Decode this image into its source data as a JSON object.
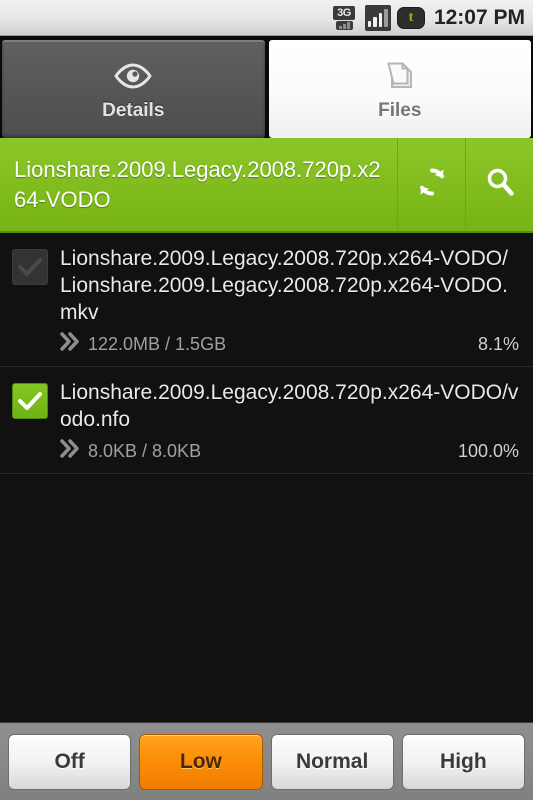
{
  "statusbar": {
    "network_label": "3G",
    "time": "12:07 PM",
    "app_glyph": "t",
    "icons": [
      "3g-network-icon",
      "signal-bars-icon",
      "transmission-app-icon"
    ]
  },
  "tabs": [
    {
      "id": "details",
      "label": "Details",
      "icon": "eye-icon",
      "active": false
    },
    {
      "id": "files",
      "label": "Files",
      "icon": "stacked-pages-icon",
      "active": true
    }
  ],
  "titlebar": {
    "torrent_name": "Lionshare.2009.Legacy.2008.720p.x264-VODO",
    "refresh_icon": "refresh-icon",
    "search_icon": "search-icon",
    "background_color": "#82bd1f"
  },
  "files": [
    {
      "name": "Lionshare.2009.Legacy.2008.720p.x264-VODO/Lionshare.2009.Legacy.2008.720p.x264-VODO.mkv",
      "downloaded": "122.0MB",
      "total": "1.5GB",
      "size_text": "122.0MB / 1.5GB",
      "percent": "8.1%",
      "checked": false,
      "checkbox_state": "unchecked-dim"
    },
    {
      "name": "Lionshare.2009.Legacy.2008.720p.x264-VODO/vodo.nfo",
      "downloaded": "8.0KB",
      "total": "8.0KB",
      "size_text": "8.0KB / 8.0KB",
      "percent": "100.0%",
      "checked": true,
      "checkbox_state": "checked-green"
    }
  ],
  "priority": {
    "selected": "Low",
    "selected_color": "#fb8f06",
    "buttons": [
      {
        "id": "off",
        "label": "Off",
        "selected": false
      },
      {
        "id": "low",
        "label": "Low",
        "selected": true
      },
      {
        "id": "normal",
        "label": "Normal",
        "selected": false
      },
      {
        "id": "high",
        "label": "High",
        "selected": false
      }
    ]
  }
}
